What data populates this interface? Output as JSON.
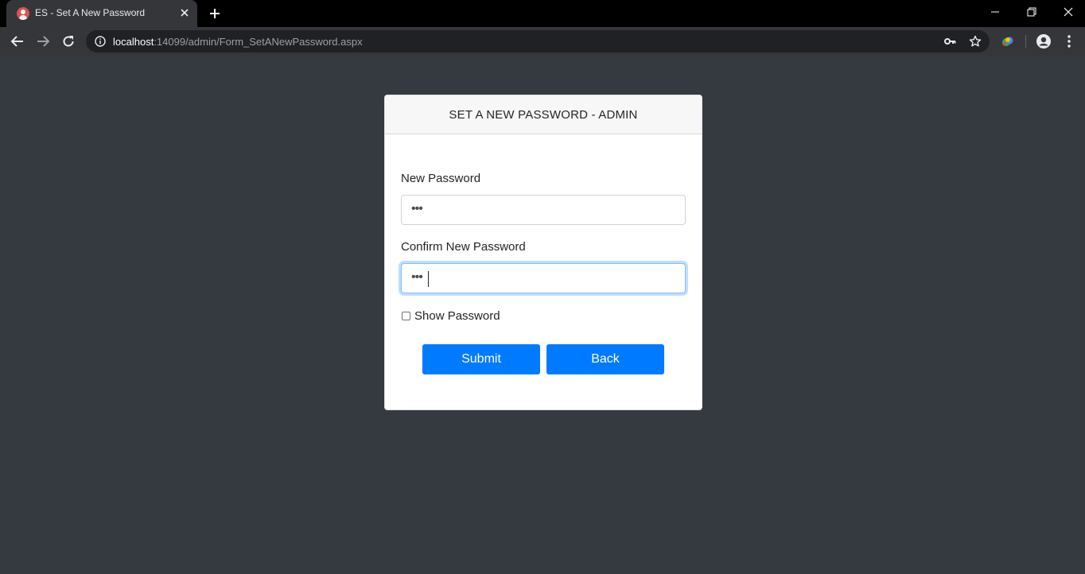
{
  "browser": {
    "tab": {
      "title": "ES - Set A New Password",
      "favicon": "user-avatar-icon"
    },
    "address": {
      "host": "localhost",
      "rest": ":14099/admin/Form_SetANewPassword.aspx"
    },
    "icons": {
      "back": "arrow-left-icon",
      "forward": "arrow-right-icon",
      "reload": "reload-icon",
      "site_info": "info-icon",
      "key": "key-icon",
      "star": "star-icon",
      "extension": "extension-icon",
      "profile": "profile-icon",
      "menu": "kebab-menu-icon"
    }
  },
  "form": {
    "title": "SET A NEW PASSWORD - ADMIN",
    "new_password": {
      "label": "New Password",
      "value": "•••"
    },
    "confirm_password": {
      "label": "Confirm New Password",
      "value": "•••"
    },
    "show_password": {
      "label": "Show Password",
      "checked": false
    },
    "submit_label": "Submit",
    "back_label": "Back"
  },
  "colors": {
    "page_background": "#343a40",
    "primary_button": "#007bff",
    "focus_border": "#80bdff"
  }
}
